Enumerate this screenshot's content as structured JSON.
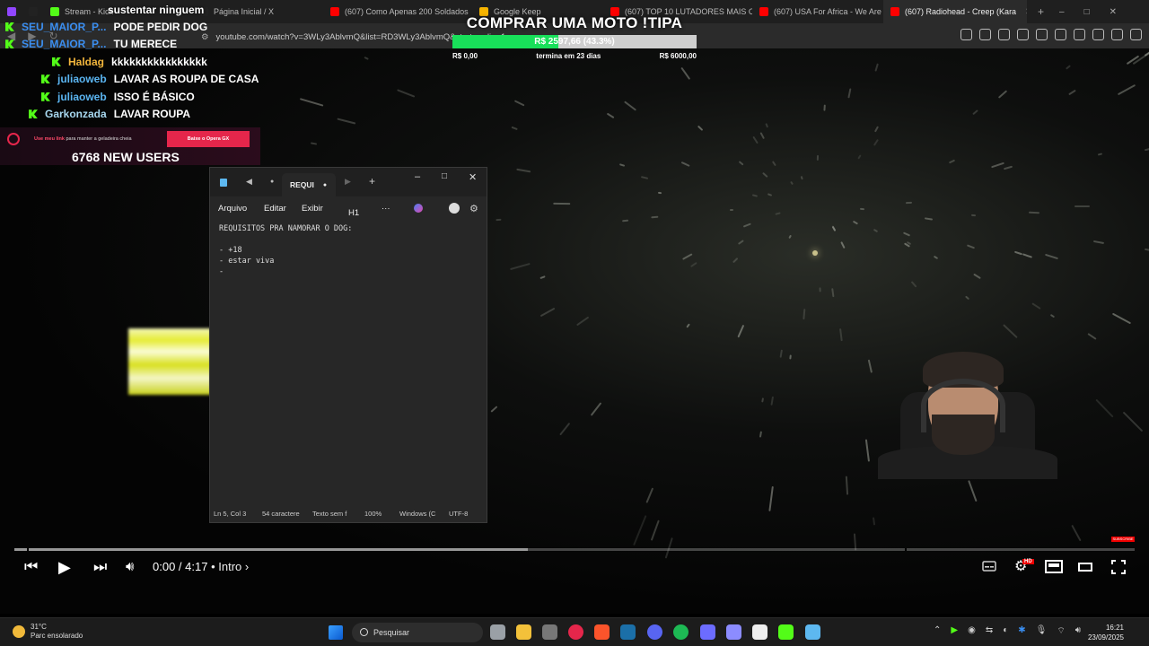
{
  "browser": {
    "tabs": [
      {
        "label": "",
        "color": "#9146ff"
      },
      {
        "label": "",
        "color": "#222222"
      },
      {
        "label": "Stream - Kick",
        "color": "#53fc18"
      },
      {
        "label": "Página Inicial / X",
        "color": "#222222"
      },
      {
        "label": "(607) Como Apenas 200 Soldados",
        "color": "#ff0000"
      },
      {
        "label": "Google Keep",
        "color": "#f6b400"
      },
      {
        "label": "(607) TOP 10 LUTADORES MAIS O",
        "color": "#ff0000"
      },
      {
        "label": "(607) USA For Africa - We Are The",
        "color": "#ff0000"
      },
      {
        "label": "(607) Radiohead - Creep (Kara",
        "color": "#ff0000",
        "active": true
      }
    ],
    "url": "youtube.com/watch?v=3WLy3AblvmQ&list=RD3WLy3AblvmQ&start_radio=1",
    "window_controls": [
      "–",
      "□",
      "✕"
    ]
  },
  "overlay": {
    "top_text": "sustentar ninguem",
    "chat": [
      {
        "user": "SEU_MAIOR_P...",
        "text": "PODE PEDIR DOG",
        "color": "#3b8ef0",
        "indent": false
      },
      {
        "user": "SEU_MAIOR_P...",
        "text": "TU MERECE",
        "color": "#3b8ef0",
        "indent": false
      },
      {
        "user": "Haldag",
        "text": "kkkkkkkkkkkkkkkk",
        "color": "#f2b63c",
        "indent": true
      },
      {
        "user": "juliaoweb",
        "text": "LAVAR AS ROUPA DE CASA",
        "color": "#5ab4f0",
        "indent": true
      },
      {
        "user": "juliaoweb",
        "text": "ISSO É BÁSICO",
        "color": "#5ab4f0",
        "indent": true
      },
      {
        "user": "Garkonzada",
        "text": "LAVAR ROUPA",
        "color": "#a8d8f0",
        "indent": true
      }
    ],
    "goal": {
      "title": "COMPRAR UMA MOTO !TIPA",
      "amount": "R$ 2597,66 (43.3%)",
      "progress": 0.433,
      "min": "R$ 0,00",
      "deadline": "termina em 23 dias",
      "max": "R$ 6000,00"
    },
    "promo": {
      "prefix": "Use meu link",
      "text": "para manter a geladeira cheia",
      "button": "Baixe o Opera GX"
    },
    "new_users": "6768 NEW USERS",
    "subscribe": "SUBSCRIBE"
  },
  "notepad": {
    "tab_label": "REQUI",
    "menu": [
      "Arquivo",
      "Editar",
      "Exibir"
    ],
    "heading": "H1",
    "more": "···",
    "content": "REQUISITOS PRA NAMORAR O DOG:\n\n- +18\n- estar viva\n-",
    "status": {
      "position": "Ln 5, Col 3",
      "chars": "54 caractere",
      "format": "Texto sem f",
      "zoom": "100%",
      "eol": "Windows (C",
      "encoding": "UTF-8"
    }
  },
  "player": {
    "time": "0:00 / 4:17",
    "chapter": "• Intro ›",
    "buffered": 0.458,
    "hd_badge": "HD"
  },
  "taskbar": {
    "temp": "31°C",
    "weather": "Parc ensolarado",
    "search_placeholder": "Pesquisar",
    "time": "16:21",
    "date": "23/09/2025"
  }
}
